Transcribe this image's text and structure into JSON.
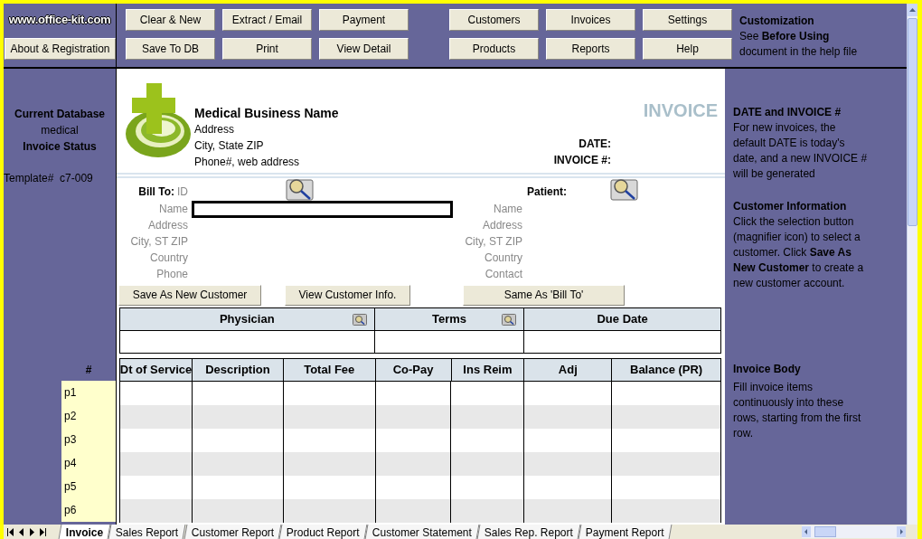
{
  "site_logo": "www.office-kit.com",
  "about_button": "About & Registration",
  "toolbar": [
    {
      "buttons": [
        "Clear & New",
        "Extract / Email",
        "Payment",
        "Save To DB",
        "Print",
        "View Detail"
      ]
    },
    {
      "buttons": [
        "Customers",
        "Invoices",
        "Settings",
        "Products",
        "Reports",
        "Help"
      ]
    }
  ],
  "customization": {
    "title": "Customization",
    "text": "See **Before Using** document in the help file"
  },
  "sidebar": {
    "database_label": "Current Database",
    "database": "medical",
    "status_label": "Invoice Status",
    "template": "Template#  c7-009"
  },
  "invoice": {
    "business_name": "Medical Business Name",
    "address_lines": [
      "Address",
      "City, State ZIP",
      "Phone#, web address"
    ],
    "title": "INVOICE",
    "date_label": "DATE:",
    "number_label": "INVOICE #:",
    "bill_to": {
      "title": "Bill To:",
      "id_label": "ID",
      "fields": [
        "Name",
        "Address",
        "City, ST ZIP",
        "Country",
        "Phone"
      ]
    },
    "patient": {
      "title": "Patient:",
      "fields": [
        "Name",
        "Address",
        "City, ST ZIP",
        "Country",
        "Contact"
      ]
    },
    "buttons": [
      "Save As New Customer",
      "View Customer Info.",
      "Same As 'Bill To'"
    ],
    "details_table": {
      "columns": [
        {
          "label": "Physician",
          "lookup": true
        },
        {
          "label": "Terms",
          "lookup": true
        },
        {
          "label": "Due Date",
          "lookup": false
        }
      ]
    },
    "items_table": {
      "row_header": "#",
      "columns": [
        "Dt of Service",
        "Description",
        "Total Fee",
        "Co-Pay",
        "Ins Reim",
        "Adj",
        "Balance (PR)"
      ],
      "row_labels": [
        "p1",
        "p2",
        "p3",
        "p4",
        "p5",
        "p6"
      ]
    }
  },
  "help_top": [
    {
      "title": "DATE and INVOICE #",
      "text": "For new invoices, the default DATE is today's date, and a new INVOICE # will be generated"
    },
    {
      "title": "Customer Information",
      "text": "Click the selection button (magnifier icon) to select a customer. Click **Save As New Customer** to create a new customer account."
    }
  ],
  "help_bottom": [
    {
      "title": "Invoice Body",
      "text": "Fill invoice items continuously into these rows, starting from the first row."
    }
  ],
  "sheet_tabs": [
    {
      "label": "Invoice",
      "selected": true
    },
    {
      "label": "Sales Report",
      "selected": false
    },
    {
      "label": "Customer Report",
      "selected": false
    },
    {
      "label": "Product Report",
      "selected": false
    },
    {
      "label": "Customer Statement",
      "selected": false
    },
    {
      "label": "Sales Rep. Report",
      "selected": false
    },
    {
      "label": "Payment Report",
      "selected": false
    }
  ]
}
